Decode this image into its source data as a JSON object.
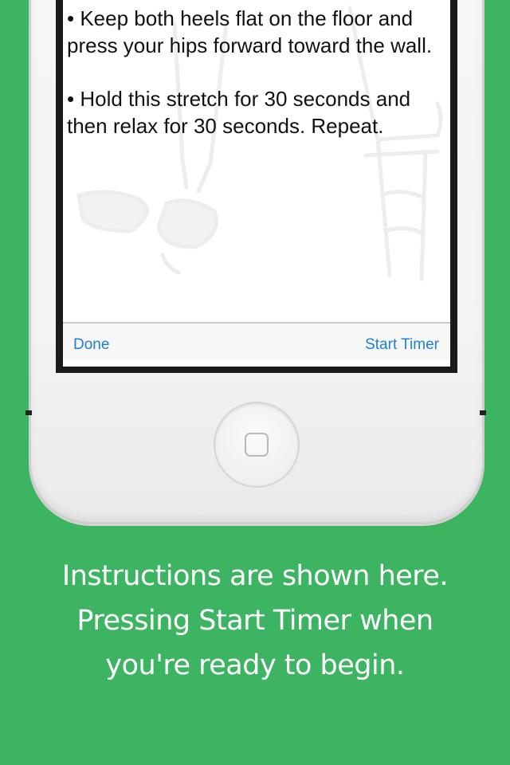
{
  "instructions": {
    "paragraph_1": "• Keep both heels flat on the floor and press your hips forward toward the wall.",
    "paragraph_2": "• Hold this stretch for 30 seconds and then relax for 30 seconds. Repeat."
  },
  "toolbar": {
    "done_label": "Done",
    "start_timer_label": "Start Timer",
    "accent_color": "#1f7fd6"
  },
  "caption": {
    "line_1": "Instructions are shown here.",
    "line_2": "Pressing Start Timer when",
    "line_3": "you're ready to begin."
  },
  "colors": {
    "background": "#3cb462",
    "caption_text": "#ffffff"
  },
  "icons": {
    "illustration": "person-stretching-with-chair-illustration",
    "home_button": "home-button-icon"
  }
}
